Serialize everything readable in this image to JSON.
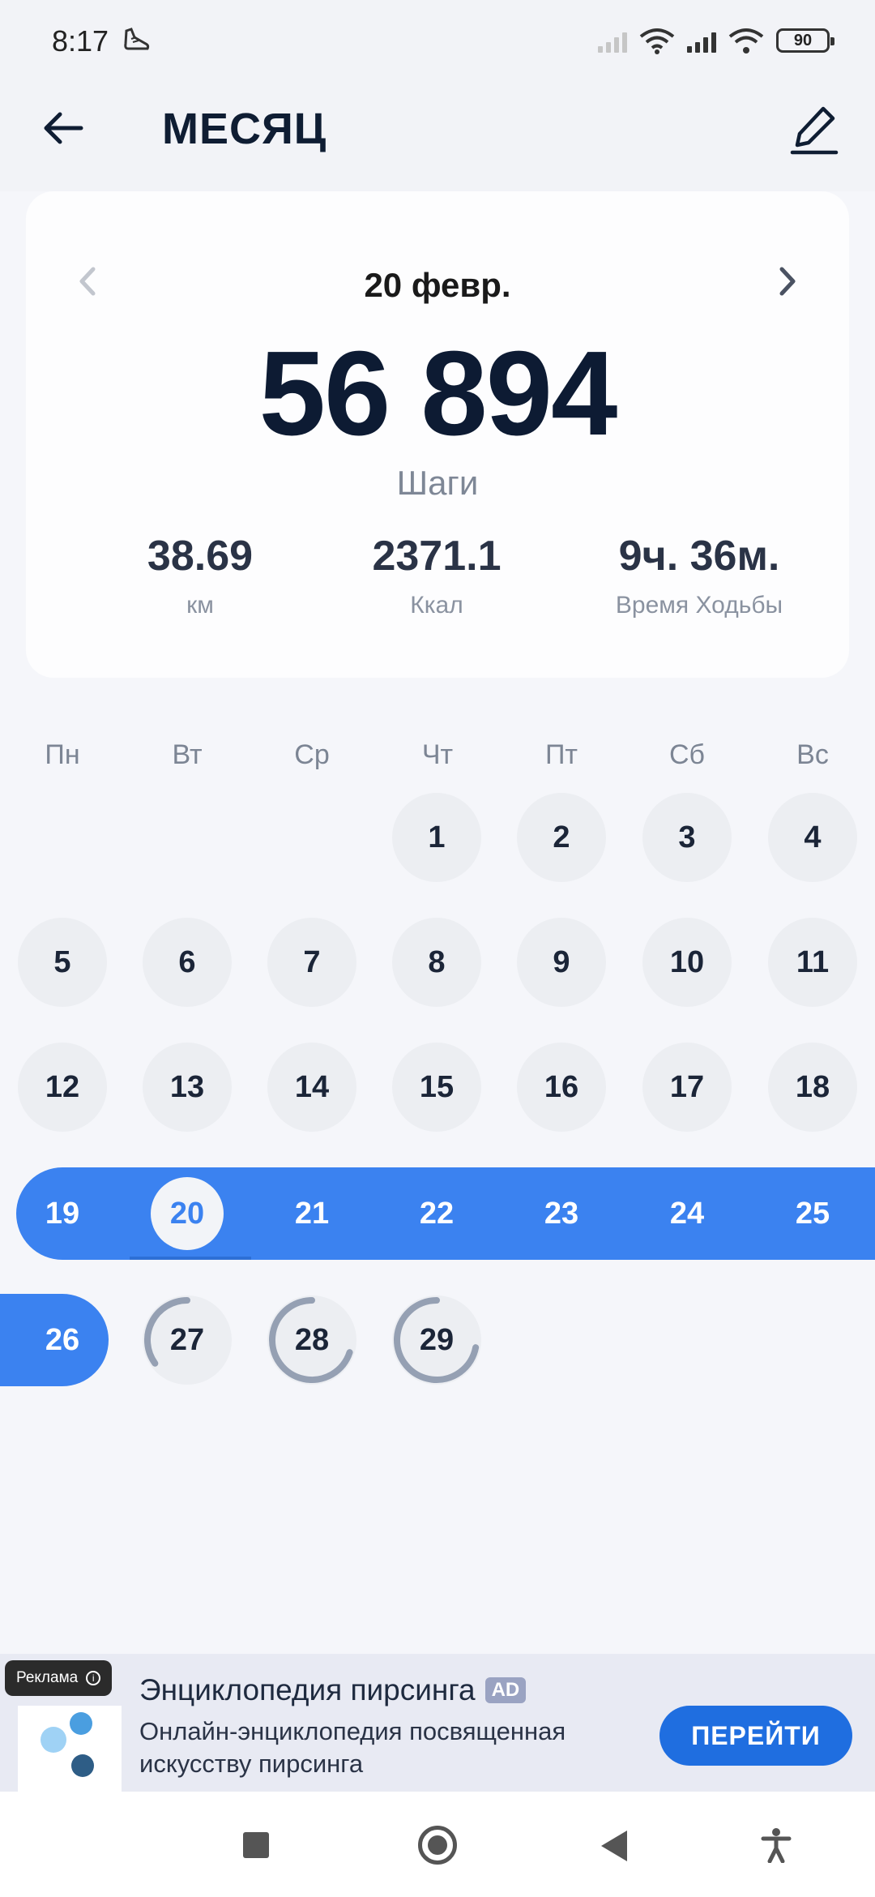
{
  "status_bar": {
    "time": "8:17",
    "battery": "90",
    "icons": [
      "shoe-icon",
      "signal-icon",
      "wifi-icon",
      "battery-icon"
    ]
  },
  "header": {
    "title": "МЕСЯЦ",
    "back_icon": "arrow-left-icon",
    "edit_icon": "pencil-icon"
  },
  "summary": {
    "date": "20 февр.",
    "steps": "56 894",
    "steps_label": "Шаги",
    "metrics": [
      {
        "value": "38.69",
        "label": "км"
      },
      {
        "value": "2371.1",
        "label": "Ккал"
      },
      {
        "value": "9ч. 36м.",
        "label": "Время Ходьбы"
      }
    ]
  },
  "calendar": {
    "weekdays": [
      "Пн",
      "Вт",
      "Ср",
      "Чт",
      "Пт",
      "Сб",
      "Вс"
    ],
    "selected_day": "20",
    "days": [
      "1",
      "2",
      "3",
      "4",
      "5",
      "6",
      "7",
      "8",
      "9",
      "10",
      "11",
      "12",
      "13",
      "14",
      "15",
      "16",
      "17",
      "18",
      "19",
      "20",
      "21",
      "22",
      "23",
      "24",
      "25",
      "26",
      "27",
      "28",
      "29"
    ],
    "goal_streak_days": [
      "19",
      "20",
      "21",
      "22",
      "23",
      "24",
      "25",
      "26"
    ],
    "partial_progress": {
      "27": 0.35,
      "28": 0.7,
      "29": 0.72
    },
    "accent_color": "#3b82f0"
  },
  "ad": {
    "badge": "Реклама",
    "title": "Энциклопедия пирсинга",
    "tag": "AD",
    "description": "Онлайн-энциклопедия посвященная искусству пирсинга",
    "cta": "ПЕРЕЙТИ"
  },
  "system_nav": {
    "buttons": [
      "recents-button",
      "home-button",
      "back-button",
      "accessibility-button"
    ]
  }
}
